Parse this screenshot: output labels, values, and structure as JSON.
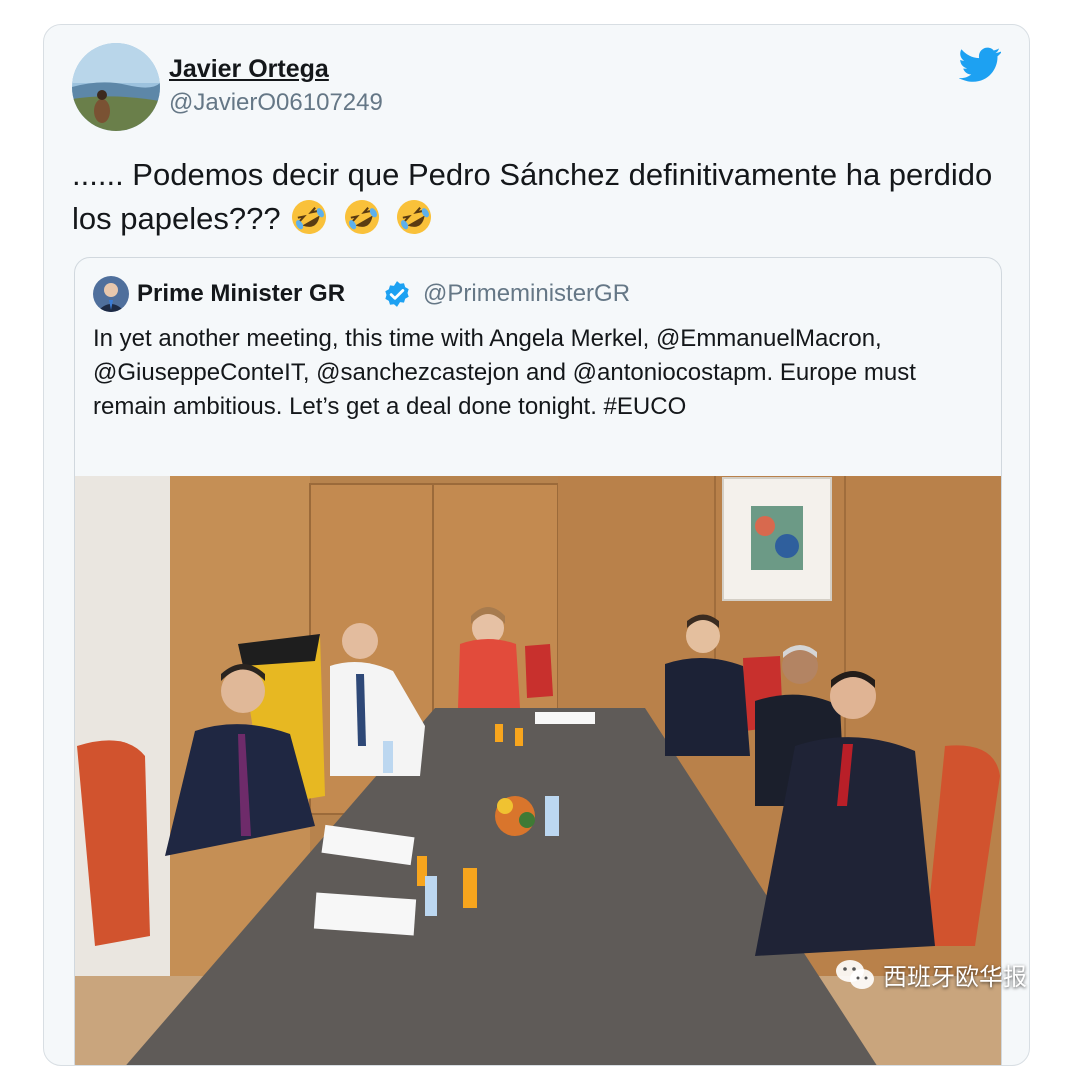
{
  "tweet": {
    "author_name": "Javier Ortega",
    "author_handle": "@JavierO06107249",
    "text": "...... Podemos decir que Pedro Sánchez definitivamente ha perdido los papeles???",
    "emojis": [
      "rolling-on-floor-laughing-icon",
      "rolling-on-floor-laughing-icon",
      "rolling-on-floor-laughing-icon"
    ]
  },
  "quoted_tweet": {
    "author_name": "Prime Minister GR",
    "author_handle": "@PrimeministerGR",
    "verified": true,
    "text": "In yet another meeting, this time with Angela Merkel, @EmmanuelMacron, @GiuseppeConteIT, @sanchezcastejon and @antoniocostapm. Europe must remain ambitious. Let’s get a deal done tonight. #EUCO",
    "media": "meeting-photo"
  },
  "watermark": {
    "text": "西班牙欧华报",
    "icon": "wechat-icon"
  },
  "colors": {
    "twitter_blue": "#1da1f2",
    "card_background": "#f5f8fa",
    "text_primary": "#14171a",
    "text_secondary": "#657786",
    "emoji_yellow": "#f9c13a"
  }
}
